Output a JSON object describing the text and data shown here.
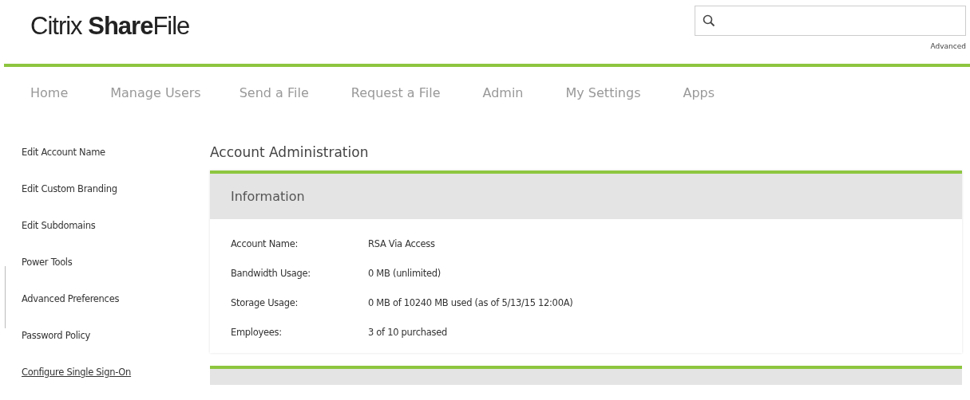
{
  "logo": "Citrix **Share**File",
  "search": {
    "link": "Advanced"
  },
  "nav": [
    {
      "label": "Home"
    },
    {
      "label": "Manage Users"
    },
    {
      "label": "Send a File"
    },
    {
      "label": "Request a File"
    },
    {
      "label": "Admin"
    },
    {
      "label": "My Settings"
    },
    {
      "label": "Apps"
    }
  ],
  "sidebar": {
    "items": [
      {
        "label": "Edit Account Name",
        "hovered": false
      },
      {
        "label": "Edit Custom Branding",
        "hovered": false
      },
      {
        "label": "Edit Subdomains",
        "hovered": false
      },
      {
        "label": "Power Tools",
        "hovered": false
      },
      {
        "label": "Advanced Preferences",
        "hovered": false
      },
      {
        "label": "Password Policy",
        "hovered": false
      },
      {
        "label": "Configure Single Sign-On",
        "hovered": true
      }
    ]
  },
  "heading": "Account Administration",
  "panel": {
    "title": "Information",
    "rows": [
      {
        "label": "Account Name:",
        "value": "RSA Via Access"
      },
      {
        "label": "Bandwidth Usage:",
        "value": "0 MB (unlimited)"
      },
      {
        "label": "Storage Usage:",
        "value": "0 MB of 10240 MB used (as of 5/13/15 12:00A)"
      },
      {
        "label": "Employees:",
        "value": "3 of 10 purchased"
      }
    ]
  }
}
